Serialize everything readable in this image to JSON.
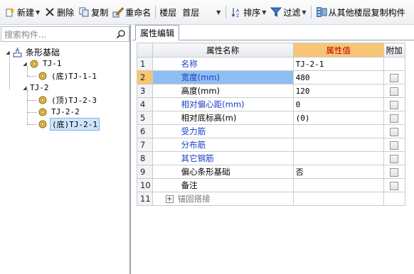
{
  "toolbar": {
    "new_label": "新建",
    "delete_label": "删除",
    "copy_label": "复制",
    "rename_label": "重命名",
    "floor_label": "楼层",
    "floor_value": "首层",
    "sort_label": "排序",
    "filter_label": "过滤",
    "copy_from_floor_label": "从其他楼层复制构件"
  },
  "search": {
    "placeholder": "搜索构件..."
  },
  "tree": {
    "root": "条形基础",
    "nodes": [
      {
        "label": "TJ-1"
      },
      {
        "label": "(底)TJ-1-1"
      },
      {
        "label": "TJ-2"
      },
      {
        "label": "(顶)TJ-2-3"
      },
      {
        "label": "TJ-2-2"
      },
      {
        "label": "(底)TJ-2-1"
      }
    ]
  },
  "tab": {
    "label": "属性编辑"
  },
  "grid": {
    "headers": {
      "name": "属性名称",
      "value": "属性值",
      "extra": "附加"
    },
    "rows": [
      {
        "num": "1",
        "name": "名称",
        "value": "TJ-2-1",
        "color": "blue"
      },
      {
        "num": "2",
        "name": "宽度(mm)",
        "value": "480",
        "color": "blue"
      },
      {
        "num": "3",
        "name": "高度(mm)",
        "value": "120",
        "color": "black"
      },
      {
        "num": "4",
        "name": "相对偏心距(mm)",
        "value": "0",
        "color": "blue"
      },
      {
        "num": "5",
        "name": "相对底标高(m)",
        "value": "(0)",
        "color": "black"
      },
      {
        "num": "6",
        "name": "受力筋",
        "value": "",
        "color": "blue"
      },
      {
        "num": "7",
        "name": "分布筋",
        "value": "",
        "color": "blue"
      },
      {
        "num": "8",
        "name": "其它钢筋",
        "value": "",
        "color": "blue"
      },
      {
        "num": "9",
        "name": "偏心条形基础",
        "value": "否",
        "color": "black"
      },
      {
        "num": "10",
        "name": "备注",
        "value": "",
        "color": "black"
      },
      {
        "num": "11",
        "name": "锚固搭接",
        "value": "",
        "color": "gray"
      }
    ]
  },
  "colors": {
    "accent": "#f7c574",
    "selection": "#8fbff2",
    "link_blue": "#1a3cc8"
  }
}
